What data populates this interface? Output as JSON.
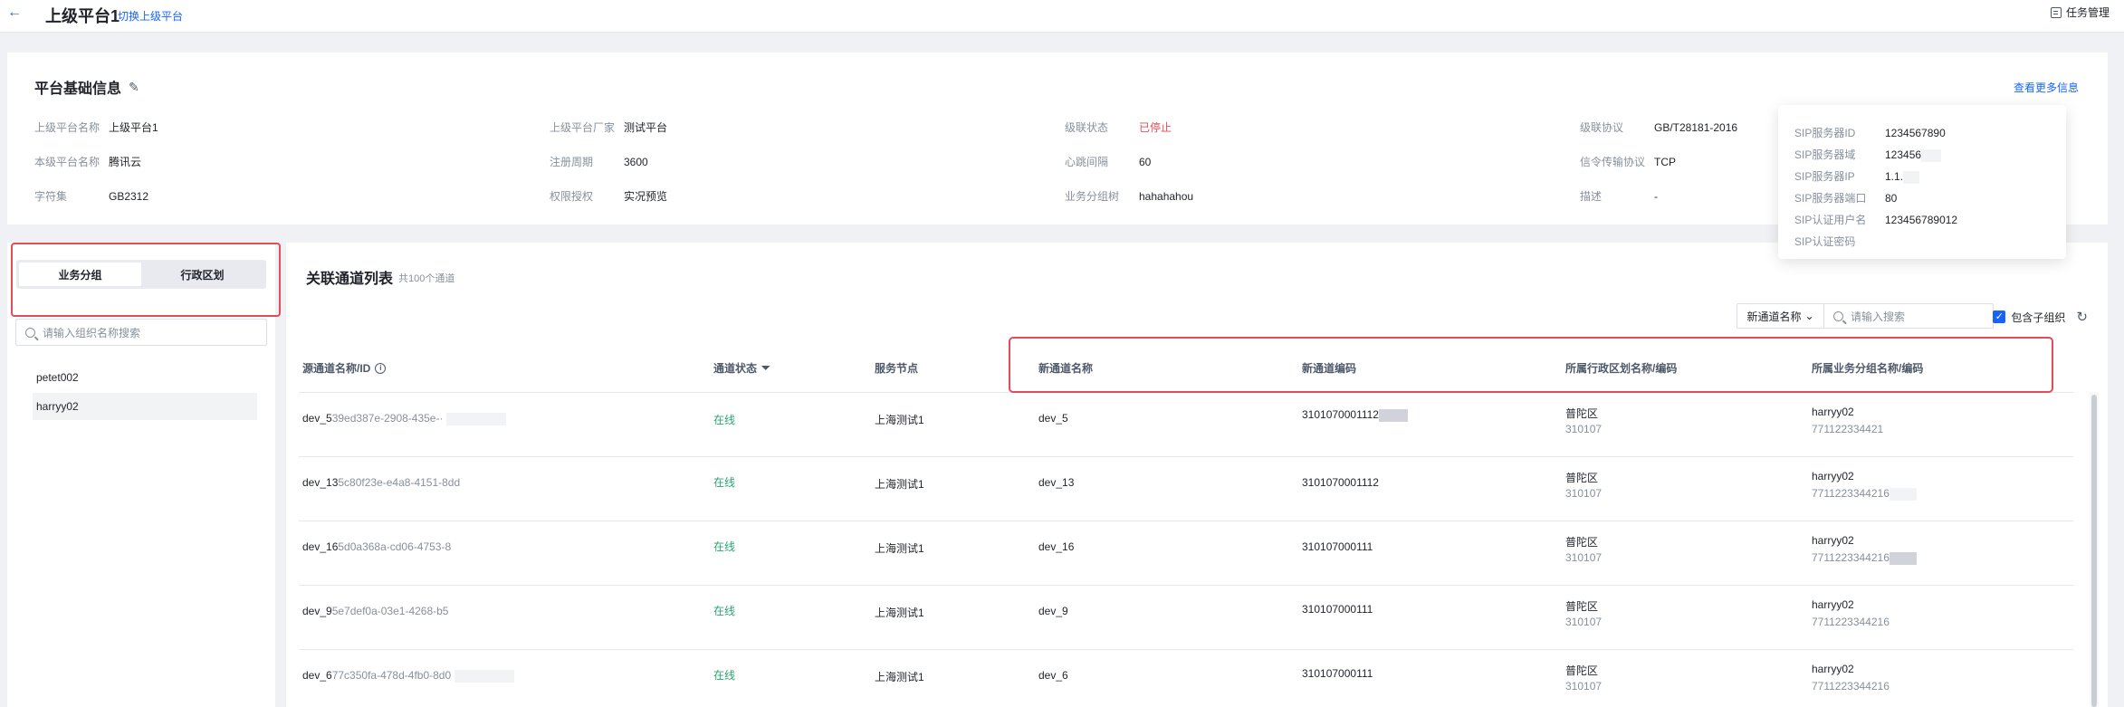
{
  "topbar": {
    "title": "上级平台1",
    "switch_link": "切换上级平台",
    "task_button": "任务管理"
  },
  "info": {
    "title": "平台基础信息",
    "more_link": "查看更多信息",
    "fields": [
      {
        "label": "上级平台名称",
        "value": "上级平台1",
        "status": "normal"
      },
      {
        "label": "上级平台厂家",
        "value": "测试平台",
        "status": "normal"
      },
      {
        "label": "级联状态",
        "value": "已停止",
        "status": "stopped"
      },
      {
        "label": "级联协议",
        "value": "GB/T28181-2016",
        "status": "normal"
      },
      {
        "label": "本级平台名称",
        "value": "腾讯云",
        "status": "normal"
      },
      {
        "label": "注册周期",
        "value": "3600",
        "status": "normal"
      },
      {
        "label": "心跳间隔",
        "value": "60",
        "status": "normal"
      },
      {
        "label": "信令传输协议",
        "value": "TCP",
        "status": "normal"
      },
      {
        "label": "字符集",
        "value": "GB2312",
        "status": "normal"
      },
      {
        "label": "权限授权",
        "value": "实况预览",
        "status": "normal"
      },
      {
        "label": "业务分组树",
        "value": "hahahahou",
        "status": "normal"
      },
      {
        "label": "描述",
        "value": "-",
        "status": "normal"
      }
    ]
  },
  "sip": {
    "rows": [
      {
        "label": "SIP服务器ID",
        "value": "1234567890"
      },
      {
        "label": "SIP服务器域",
        "value": "123456"
      },
      {
        "label": "SIP服务器IP",
        "value": "1.1."
      },
      {
        "label": "SIP服务器端口",
        "value": "80"
      },
      {
        "label": "SIP认证用户名",
        "value": "123456789012"
      },
      {
        "label": "SIP认证密码",
        "value": ""
      }
    ]
  },
  "sidebar": {
    "tabs": [
      {
        "label": "业务分组",
        "active": true
      },
      {
        "label": "行政区划",
        "active": false
      }
    ],
    "search_placeholder": "请输入组织名称搜索",
    "groups": [
      {
        "label": "petet002",
        "selected": false
      },
      {
        "label": "harryy02",
        "selected": true
      }
    ]
  },
  "channels": {
    "title": "关联通道列表",
    "count": "共100个通道",
    "filter_select": "新通道名称",
    "search_placeholder": "请输入搜索",
    "include_sub": "包含子组织",
    "columns": [
      "源通道名称/ID",
      "通道状态",
      "服务节点",
      "新通道名称",
      "新通道编码",
      "所属行政区划名称/编码",
      "所属业务分组名称/编码"
    ],
    "rows": [
      {
        "src_name": "dev_5",
        "src_id": "39ed387e-2908-435e-·",
        "status": "在线",
        "node": "上海测试1",
        "new_name": "dev_5",
        "new_code": "3101070001112",
        "region": "普陀区",
        "region_code": "310107",
        "group": "harryy02",
        "group_code": "771122334421"
      },
      {
        "src_name": "dev_13",
        "src_id": "5c80f23e-e4a8-4151-8dd",
        "status": "在线",
        "node": "上海测试1",
        "new_name": "dev_13",
        "new_code": "3101070001112",
        "region": "普陀区",
        "region_code": "310107",
        "group": "harryy02",
        "group_code": "7711223344216"
      },
      {
        "src_name": "dev_16",
        "src_id": "5d0a368a-cd06-4753-8",
        "status": "在线",
        "node": "上海测试1",
        "new_name": "dev_16",
        "new_code": "310107000111",
        "region": "普陀区",
        "region_code": "310107",
        "group": "harryy02",
        "group_code": "7711223344216"
      },
      {
        "src_name": "dev_9",
        "src_id": "5e7def0a-03e1-4268-b5",
        "status": "在线",
        "node": "上海测试1",
        "new_name": "dev_9",
        "new_code": "310107000111",
        "region": "普陀区",
        "region_code": "310107",
        "group": "harryy02",
        "group_code": "7711223344216"
      },
      {
        "src_name": "dev_6",
        "src_id": "77c350fa-478d-4fb0-8d0",
        "status": "在线",
        "node": "上海测试1",
        "new_name": "dev_6",
        "new_code": "310107000111",
        "region": "普陀区",
        "region_code": "310107",
        "group": "harryy02",
        "group_code": "7711223344216"
      }
    ]
  },
  "colors": {
    "accent": "#1664ff",
    "online": "#2ba471",
    "stopped": "#e34d59",
    "highlight_outline": "#e34d59"
  }
}
